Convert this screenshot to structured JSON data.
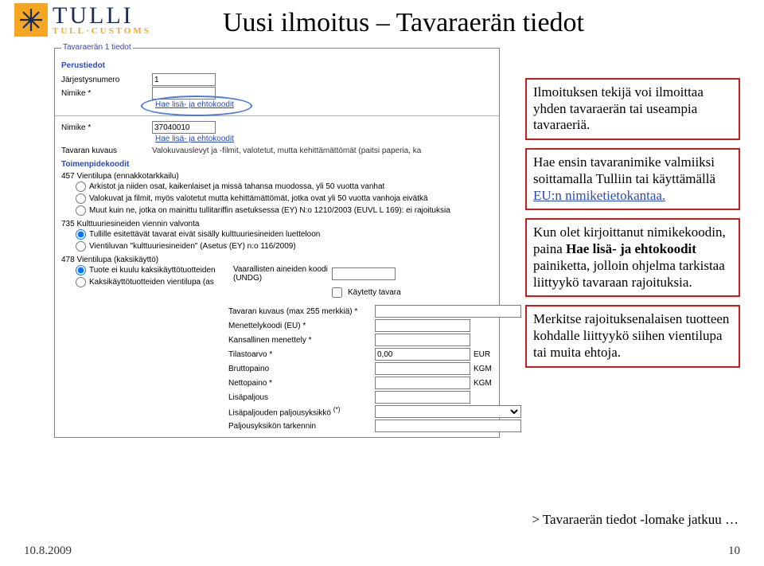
{
  "logo": {
    "word": "TULLI",
    "sub": "TULL·CUSTOMS"
  },
  "title": "Uusi ilmoitus – Tavaraerän tiedot",
  "shot": {
    "fieldset_label": "Tavaraerän 1 tiedot",
    "section_perustiedot": "Perustiedot",
    "jarjestysnumero_lbl": "Järjestysnumero",
    "jarjestysnumero_val": "1",
    "nimike_lbl": "Nimike *",
    "nimike_val1": "",
    "hae_link": "Hae lisä- ja ehtokoodit",
    "nimike_val2": "37040010",
    "hae_link2": "Hae lisä- ja ehtokoodit",
    "tavaran_kuvaus_lbl": "Tavaran kuvaus",
    "tavaran_kuvaus_val": "Valokuvauslevyt ja -filmit, valotetut, mutta kehittämättömät (paitsi paperia, ka",
    "section_toimenpide": "Toimenpidekoodit",
    "t457": "457 Vientilupa (ennakkotarkkailu)",
    "t457_opt1": "Arkistot ja niiden osat, kaikenlaiset ja missä tahansa muodossa, yli 50 vuotta vanhat",
    "t457_opt2": "Valokuvat ja filmit, myös valotetut mutta kehittämättömät, jotka ovat yli 50 vuotta vanhoja eivätkä",
    "t457_opt3": "Muut kuin ne, jotka on mainittu tullitariffin asetuksessa (EY) N:o 1210/2003 (EUVL L 169): ei rajoituksia",
    "t735": "735 Kulttuuriesineiden viennin valvonta",
    "t735_opt1": "Tullille esitettävät tavarat eivät sisälly kulttuuriesineiden luetteloon",
    "t735_opt2": "Vientiluvan \"kulttuuriesineiden\" (Asetus (EY) n:o 116/2009)",
    "t478": "478 Vientilupa (kaksikäyttö)",
    "t478_opt1": "Tuote ei kuulu kaksikäyttötuotteiden",
    "t478_opt2": "Kaksikäyttötuotteiden vientilupa (as",
    "vaarallisten_lbl": "Vaarallisten aineiden koodi (UNDG)",
    "kaytetty_lbl": "Käytetty tavara",
    "kuvaus255_lbl": "Tavaran kuvaus (max 255 merkkiä) *",
    "menettelykoodi_lbl": "Menettelykoodi (EU) *",
    "kansallinen_lbl": "Kansallinen menettely *",
    "tilastoarvo_lbl": "Tilastoarvo *",
    "tilastoarvo_val": "0,00",
    "tilastoarvo_unit": "EUR",
    "bruttopaino_lbl": "Bruttopaino",
    "bruttopaino_unit": "KGM",
    "nettopaino_lbl": "Nettopaino *",
    "nettopaino_unit": "KGM",
    "lisapaljous_lbl": "Lisäpaljous",
    "lisapaljouden_lbl": "Lisäpaljouden paljousyksikkö",
    "paljousyksikon_lbl": "Paljousyksikön tarkennin",
    "asterisk": "(*)"
  },
  "callouts": {
    "c1": "Ilmoituksen tekijä voi ilmoittaa yhden tavaraerän tai useampia tavaraeriä.",
    "c2a": "Hae ensin tavaranimike valmiiksi soittamalla Tulliin tai käyttämällä ",
    "c2b": "EU:n nimiketietokantaa.",
    "c3a": "Kun olet kirjoittanut nimikekoodin, paina ",
    "c3b": "Hae lisä- ja ehtokoodit",
    "c3c": " painiketta, jolloin ohjelma tarkistaa liittyykö tavaraan rajoituksia.",
    "c4": "Merkitse rajoituksenalaisen tuotteen kohdalle liittyykö siihen vientilupa tai muita ehtoja."
  },
  "continue_line": "> Tavaraerän tiedot -lomake jatkuu …",
  "footer": {
    "date": "10.8.2009",
    "page": "10"
  }
}
